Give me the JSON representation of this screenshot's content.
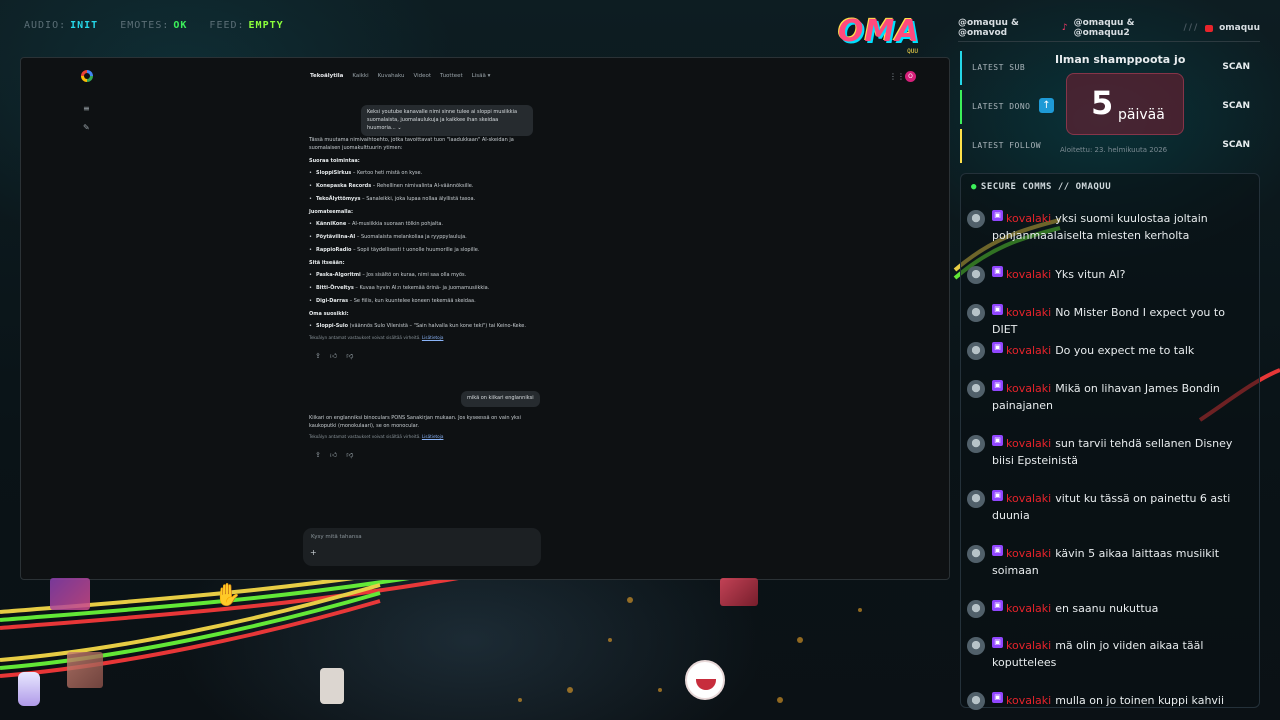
{
  "status": {
    "audio_label": "AUDIO:",
    "audio_value": "INIT",
    "emotes_label": "EMOTES:",
    "emotes_value": "OK",
    "feed_label": "FEED:",
    "feed_value": "EMPTY"
  },
  "logo": {
    "text": "OMA",
    "sub": "QUU"
  },
  "colors": {
    "accent_cyan": "#25d7e8",
    "accent_green": "#3cf05a",
    "twitch_purple": "#9146ff",
    "username_red": "#e5232b",
    "counter_bg": "#7a1e32"
  },
  "browser": {
    "nav": [
      "Tekoälytila",
      "Kaikki",
      "Kuvahaku",
      "Videot",
      "Tuotteet",
      "Lisää ▾"
    ],
    "avatar_letter": "O",
    "user_message_1": "Keksi youtube kanavalle nimi sinne tulee ai sloppi musiikkia suomalaista, juomalaulukuja ja kaikkee ihan skeidaa huumoria...",
    "intro": "Tässä muutama nimivaihtoehto, jotka tavoittavat tuon \"laadukkaan\" AI-skeidan ja suomalaisen juomakulttuurin ytimen:",
    "groups": [
      {
        "heading": "Suoraa toimintaa:",
        "items": [
          {
            "name": "SloppiSirkus",
            "desc": " – Kertoo heti mistä on kyse."
          },
          {
            "name": "Konepaska Records",
            "desc": " – Rehellinen nimivalinta AI-väännöksille."
          },
          {
            "name": "TekoÄlyttömyys",
            "desc": " – Sanaleikki, joka lupaa nollaa älyllistä tasoa."
          }
        ]
      },
      {
        "heading": "Juomateemalla:",
        "items": [
          {
            "name": "KänniKone",
            "desc": " – AI-musiikkia suoraan tölkin pohjalta."
          },
          {
            "name": "Pöytävilina-AI",
            "desc": " – Suomalaista melankoliaa ja ryyppylauluja."
          },
          {
            "name": "RappioRadio",
            "desc": " – Sopii täydellisesti t uonolle huumorille ja slopille."
          }
        ]
      },
      {
        "heading": "Sitä itseään:",
        "items": [
          {
            "name": "Paska-Algoritmi",
            "desc": " – Jos sisältö on kuraa, nimi saa olla myös."
          },
          {
            "name": "Bitti-Örveltys",
            "desc": " – Kuvaa hyvin AI:n tekemää örinä- ja juomamusiikkia."
          },
          {
            "name": "Digi-Darras",
            " desc": "",
            "desc": " – Se fiilis, kun kuuntelee koneen tekemää skeidaa."
          }
        ]
      },
      {
        "heading": "Oma suosikki:",
        "items": [
          {
            "name": "Sloppi-Sulo",
            "desc": " (väännös Sulo Vilenistä – \"Sain halvalla kun kone teki\") tai Keino-Keke."
          }
        ]
      }
    ],
    "disclaimer": "Tekoälyn antamat vastaukset voivat sisältää virheitä.",
    "disclaimer_link": "Lisätietoja",
    "user_message_2": "mikä on kiikari englanniksi",
    "answer_2": "Kiikari on englanniksi binoculars PONS Sanakirjan mukaan. Jos kyseessä on vain yksi kaukoputki (monokulaari), se on monocular.",
    "input_placeholder": "Kysy mitä tahansa",
    "input_plus": "+"
  },
  "right_panel": {
    "handle_1": "@omaquu & @omavod",
    "handle_2": "@omaquu & @omaquu2",
    "separator": "///",
    "handle_3": "omaquu",
    "latest_sub_label": "LATEST SUB",
    "latest_sub_value": "Ilman shamppoota jo",
    "latest_dono_label": "LATEST DONO",
    "latest_follow_label": "LATEST FOLLOW",
    "scan": "SCAN",
    "counter_number": "5",
    "counter_unit": "päivää",
    "started": "Aloitettu: 23. helmikuuta 2026"
  },
  "comms": {
    "title": "SECURE COMMS // OMAQUU",
    "messages": [
      {
        "user": "kovalaki",
        "text": "yksi suomi kuulostaa joltain pohjanmaalaiselta miesten kerholta"
      },
      {
        "user": "kovalaki",
        "text": "Yks vitun AI?"
      },
      {
        "user": "kovalaki",
        "text": "No Mister Bond I expect you to DIET"
      },
      {
        "user": "kovalaki",
        "text": "Do you expect me to talk"
      },
      {
        "user": "kovalaki",
        "text": "Mikä on lihavan James Bondin painajanen"
      },
      {
        "user": "kovalaki",
        "text": "sun tarvii tehdä sellanen Disney biisi Epsteinistä"
      },
      {
        "user": "kovalaki",
        "text": "vitut ku tässä on painettu 6 asti duunia"
      },
      {
        "user": "kovalaki",
        "text": "kävin 5 aikaa laittaas musiikit soimaan"
      },
      {
        "user": "kovalaki",
        "text": "en saanu nukuttua"
      },
      {
        "user": "kovalaki",
        "text": "mä olin jo viiden aikaa tääl koputtelees"
      },
      {
        "user": "kovalaki",
        "text": "mulla on jo toinen kuppi kahvii"
      }
    ]
  }
}
